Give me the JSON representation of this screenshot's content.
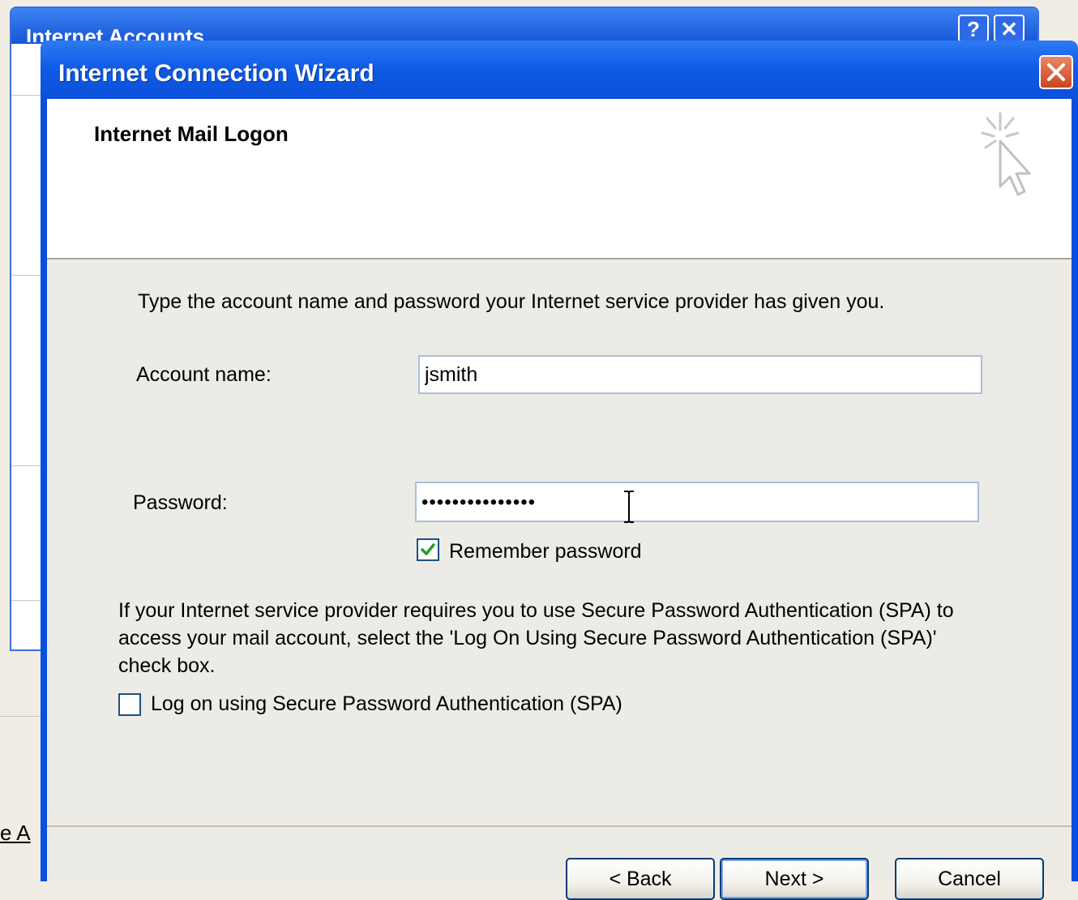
{
  "background_window": {
    "title": "Internet Accounts",
    "help_button": "?",
    "close_button": "✕",
    "link_fragment": "e A"
  },
  "wizard": {
    "title": "Internet Connection Wizard",
    "header_title": "Internet Mail Logon",
    "instruction": "Type the account name and password your Internet service provider has given you.",
    "account_name": {
      "label": "Account name:",
      "value": "jsmith"
    },
    "password": {
      "label": "Password:",
      "value": "•••••••••••••••"
    },
    "remember_password": {
      "label": "Remember password",
      "checked": true
    },
    "spa_info": "If your Internet service provider requires you to use Secure Password Authentication (SPA) to access your mail account, select the 'Log On Using Secure Password Authentication (SPA)' check box.",
    "spa_checkbox": {
      "label": "Log on using Secure Password Authentication (SPA)",
      "checked": false
    },
    "buttons": {
      "back": "< Back",
      "next": "Next >",
      "cancel": "Cancel"
    }
  },
  "colors": {
    "titlebar": "#0b4fd8",
    "close_button": "#c9451f",
    "dialog_body": "#ecebe5",
    "checkmark": "#21a121"
  }
}
